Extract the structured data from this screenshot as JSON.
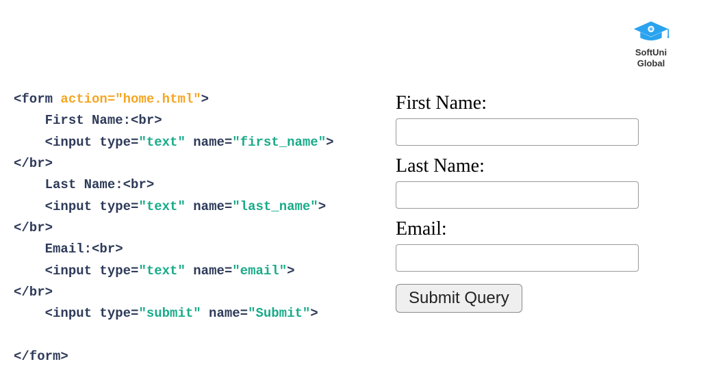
{
  "logo": {
    "line1": "SoftUni",
    "line2": "Global"
  },
  "code": {
    "l1_open_tag": "<form ",
    "l1_attr": "action=",
    "l1_val": "\"home.html\"",
    "l1_close": ">",
    "l2_text": "    First Name:",
    "l2_br": "<br>",
    "l3_a": "    <input type=",
    "l3_v1": "\"text\"",
    "l3_b": " name=",
    "l3_v2": "\"first_name\"",
    "l3_c": ">",
    "l4": "</br>",
    "l5_text": "    Last Name:",
    "l5_br": "<br>",
    "l6_a": "    <input type=",
    "l6_v1": "\"text\"",
    "l6_b": " name=",
    "l6_v2": "\"last_name\"",
    "l6_c": ">",
    "l7": "</br>",
    "l8_text": "    Email:",
    "l8_br": "<br>",
    "l9_a": "    <input type=",
    "l9_v1": "\"text\"",
    "l9_b": " name=",
    "l9_v2": "\"email\"",
    "l9_c": ">",
    "l10": "</br>",
    "l11_a": "    <input type=",
    "l11_v1": "\"submit\"",
    "l11_b": " name=",
    "l11_v2": "\"Submit\"",
    "l11_c": ">",
    "l13": "</form>"
  },
  "form": {
    "label_first": "First Name:",
    "label_last": "Last Name:",
    "label_email": "Email:",
    "submit_label": "Submit Query"
  }
}
